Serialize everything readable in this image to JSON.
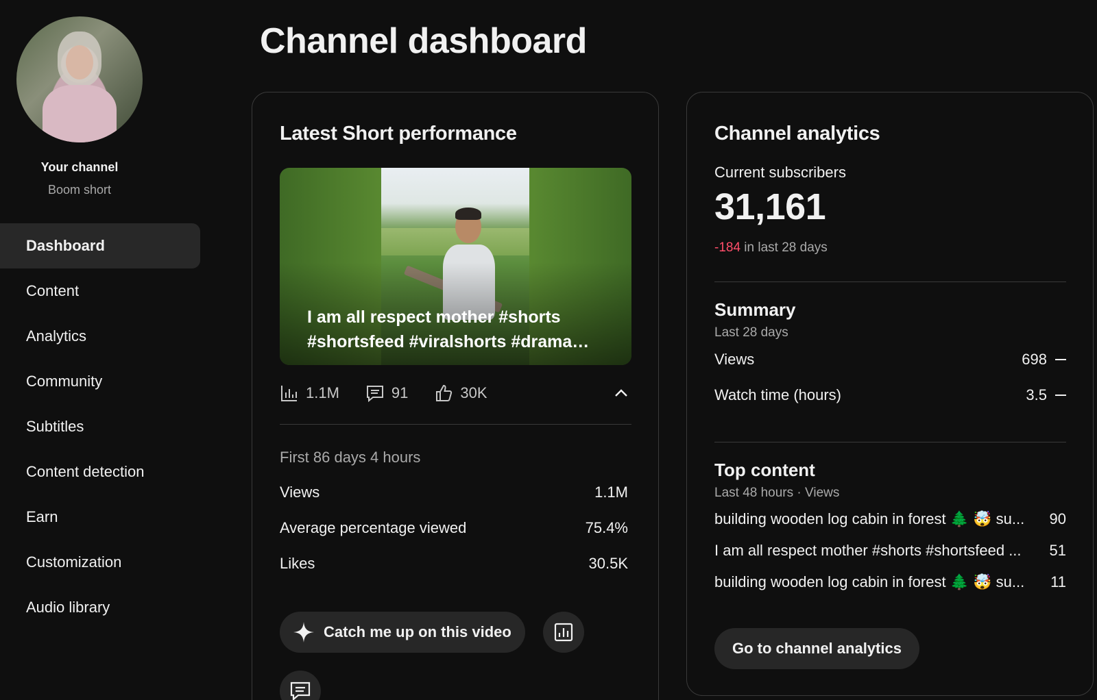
{
  "sidebar": {
    "your_channel": "Your channel",
    "channel_name": "Boom short",
    "items": [
      {
        "label": "Dashboard"
      },
      {
        "label": "Content"
      },
      {
        "label": "Analytics"
      },
      {
        "label": "Community"
      },
      {
        "label": "Subtitles"
      },
      {
        "label": "Content detection"
      },
      {
        "label": "Earn"
      },
      {
        "label": "Customization"
      },
      {
        "label": "Audio library"
      }
    ]
  },
  "page": {
    "title": "Channel dashboard"
  },
  "latest_short": {
    "title": "Latest Short performance",
    "caption": "I am all respect mother #shorts #shortsfeed #viralshorts #drama…",
    "stats": {
      "views": "1.1M",
      "comments": "91",
      "likes": "30K"
    },
    "period": "First 86 days 4 hours",
    "metrics": [
      {
        "label": "Views",
        "value": "1.1M"
      },
      {
        "label": "Average percentage viewed",
        "value": "75.4%"
      },
      {
        "label": "Likes",
        "value": "30.5K"
      }
    ],
    "catch_up_label": "Catch me up on this video"
  },
  "channel_analytics": {
    "title": "Channel analytics",
    "subscribers_label": "Current subscribers",
    "subscribers": "31,161",
    "change": "-184",
    "change_suffix": " in last 28 days",
    "summary": {
      "title": "Summary",
      "period": "Last 28 days",
      "rows": [
        {
          "label": "Views",
          "value": "698"
        },
        {
          "label": "Watch time (hours)",
          "value": "3.5"
        }
      ]
    },
    "top_content": {
      "title": "Top content",
      "period": "Last 48 hours · Views",
      "rows": [
        {
          "title": "building wooden log cabin in forest 🌲 🤯 su...",
          "value": "90"
        },
        {
          "title": "I am all respect mother #shorts #shortsfeed ...",
          "value": "51"
        },
        {
          "title": "building wooden log cabin in forest 🌲 🤯 su...",
          "value": "11"
        }
      ]
    },
    "button_label": "Go to channel analytics"
  },
  "colors": {
    "background": "#0f0f0f",
    "card_border": "#3a3a3a",
    "negative": "#ff4e6a",
    "button": "#272727"
  }
}
